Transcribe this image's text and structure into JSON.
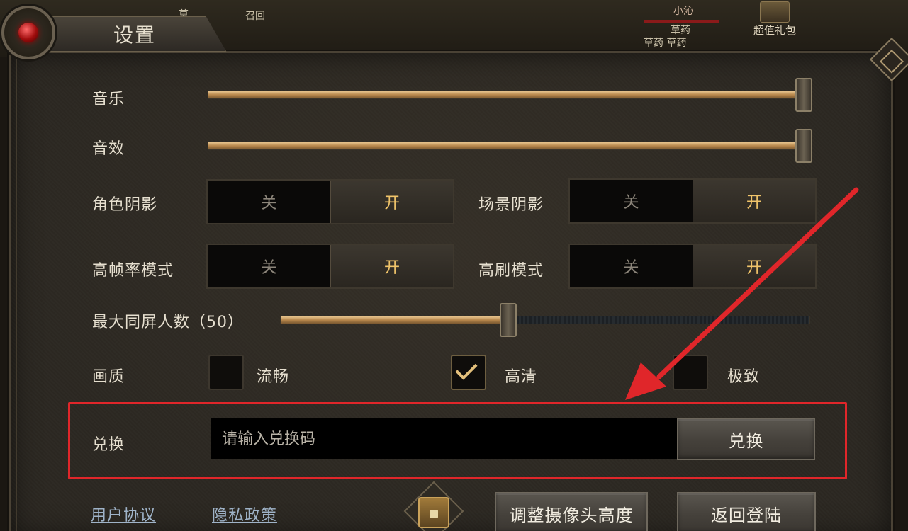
{
  "window": {
    "title": "设置"
  },
  "scene": {
    "npc_top": "草",
    "summon": "召回",
    "player_name": "小沁",
    "herb_1": "草药",
    "herb_2": "草药 草药",
    "gift_label": "超值礼包"
  },
  "audio": {
    "music_label": "音乐",
    "music_value": 100,
    "sfx_label": "音效",
    "sfx_value": 100
  },
  "toggles": [
    {
      "label": "角色阴影",
      "off": "关",
      "on": "开",
      "state": "on"
    },
    {
      "label": "场景阴影",
      "off": "关",
      "on": "开",
      "state": "on"
    },
    {
      "label": "高帧率模式",
      "off": "关",
      "on": "开",
      "state": "on"
    },
    {
      "label": "高刷模式",
      "off": "关",
      "on": "开",
      "state": "on"
    }
  ],
  "max_players": {
    "label": "最大同屏人数（50）",
    "value": 50,
    "fraction": 0.43
  },
  "quality": {
    "label": "画质",
    "options": [
      {
        "label": "流畅",
        "checked": false
      },
      {
        "label": "高清",
        "checked": true
      },
      {
        "label": "极致",
        "checked": false
      }
    ]
  },
  "redeem": {
    "label": "兑换",
    "placeholder": "请输入兑换码",
    "value": "",
    "button": "兑换"
  },
  "footer": {
    "user_agreement": "用户协议",
    "privacy_policy": "隐私政策",
    "camera_button": "调整摄像头高度",
    "back_button": "返回登陆"
  },
  "colors": {
    "accent_gold": "#f0c46a",
    "annotation_red": "#e0262a",
    "panel_bg": "#2c2822"
  }
}
